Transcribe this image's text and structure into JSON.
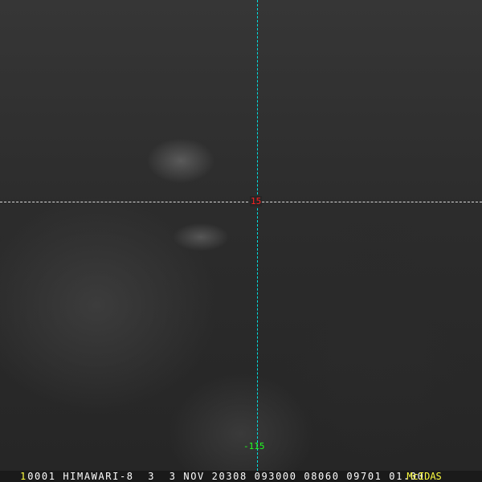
{
  "overlay": {
    "latitude_label": "15",
    "longitude_label": "-115"
  },
  "status_bar": {
    "frame": "1",
    "info": "0001 HIMAWARI-8  3  3 NOV 20308 093000 08060 09701 01.00",
    "logo": "McIDAS"
  },
  "colors": {
    "lat_label": "#ff2020",
    "lon_label": "#20ff20",
    "grid_lon": "#00e0e0",
    "logo": "#ffff40"
  }
}
